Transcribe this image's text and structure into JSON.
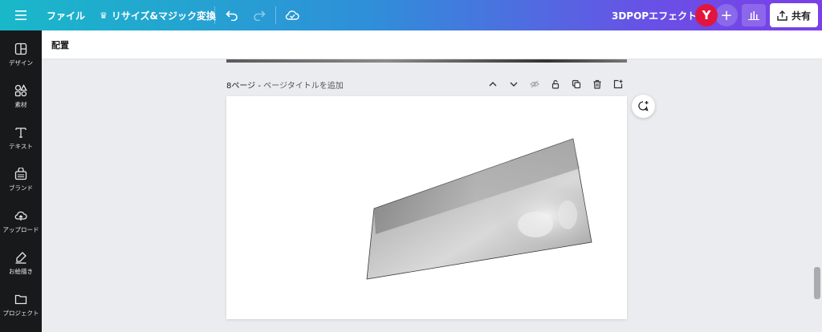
{
  "topbar": {
    "file_label": "ファイル",
    "resize_label": "リサイズ&マジック変換",
    "project_title": "3DPOPエフェクト",
    "avatar_initial": "Y",
    "add_label": "+",
    "share_label": "共有"
  },
  "sidebar": {
    "items": [
      {
        "label": "デザイン",
        "icon": "layout-icon"
      },
      {
        "label": "素材",
        "icon": "shapes-icon"
      },
      {
        "label": "テキスト",
        "icon": "text-icon"
      },
      {
        "label": "ブランド",
        "icon": "brand-icon"
      },
      {
        "label": "アップロード",
        "icon": "upload-icon"
      },
      {
        "label": "お絵描き",
        "icon": "draw-icon"
      },
      {
        "label": "プロジェクト",
        "icon": "folder-icon"
      }
    ]
  },
  "subbar": {
    "arrange_label": "配置"
  },
  "page": {
    "number_label": "8ページ - ",
    "title_placeholder": "ページタイトルを追加"
  },
  "colors": {
    "avatar": "#e0163e",
    "rail_bg": "#18191b",
    "canvas_bg": "#ebecf0"
  }
}
